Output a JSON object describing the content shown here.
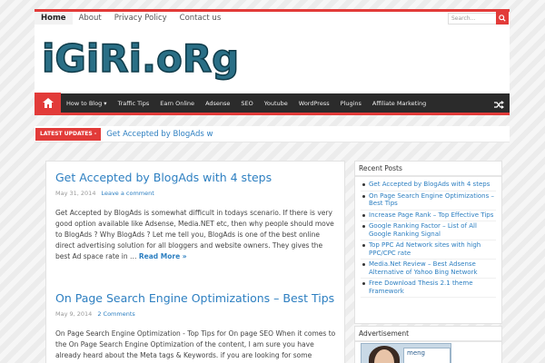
{
  "topnav": {
    "items": [
      "Home",
      "About",
      "Privacy Policy",
      "Contact us"
    ],
    "search_placeholder": "Search..."
  },
  "logo": {
    "text": "iGiRi.oRg"
  },
  "mainnav": {
    "items": [
      "How to Blog",
      "Traffic Tips",
      "Earn Online",
      "Adsense",
      "SEO",
      "Youtube",
      "WordPress",
      "Plugins",
      "Affiliate Marketing"
    ]
  },
  "ticker": {
    "label": "LATEST UPDATES -",
    "text": "Get Accepted by BlogAds w"
  },
  "posts": [
    {
      "title": "Get Accepted by BlogAds with 4 steps",
      "date": "May 31, 2014",
      "comments": "Leave a comment",
      "excerpt": "Get Accepted by BlogAds is somewhat difficult in todays scenario. If there is very good option available like Adsense, Media.NET etc, then why people should move to BlogAds ? Why BlogAds ? Let me tell you, BlogAds is one of the best online direct advertising solution for all bloggers and website owners. They gives the best Ad space rate in …",
      "more": "Read More »"
    },
    {
      "title": "On Page Search Engine Optimizations – Best Tips",
      "date": "May 9, 2014",
      "comments": "2 Comments",
      "excerpt": "On Page Search Engine Optimization - Top Tips for On page SEO When it comes to the On Page Search Engine Optimization of the content, I am sure you have already heard about the Meta tags & Keywords. if you are looking for some effective and",
      "more": ""
    }
  ],
  "sidebar": {
    "recent_title": "Recent Posts",
    "recent": [
      "Get Accepted by BlogAds with 4 steps",
      "On Page Search Engine Optimizations – Best Tips",
      "Increase Page Rank – Top Effective Tips",
      "Google Ranking Factor – List of All Google Ranking Signal",
      "Top PPC Ad Network sites with high PPC/CPC rate",
      "Media.Net Review – Best Adsense Alternative of Yahoo Bing Network",
      "Free Download Thesis 2.1 theme Framework"
    ],
    "adv_title": "Advertisement",
    "ad_label": "meng"
  },
  "colors": {
    "accent": "#e23b39",
    "link": "#2d7fc1",
    "nav": "#2b2b2b"
  }
}
